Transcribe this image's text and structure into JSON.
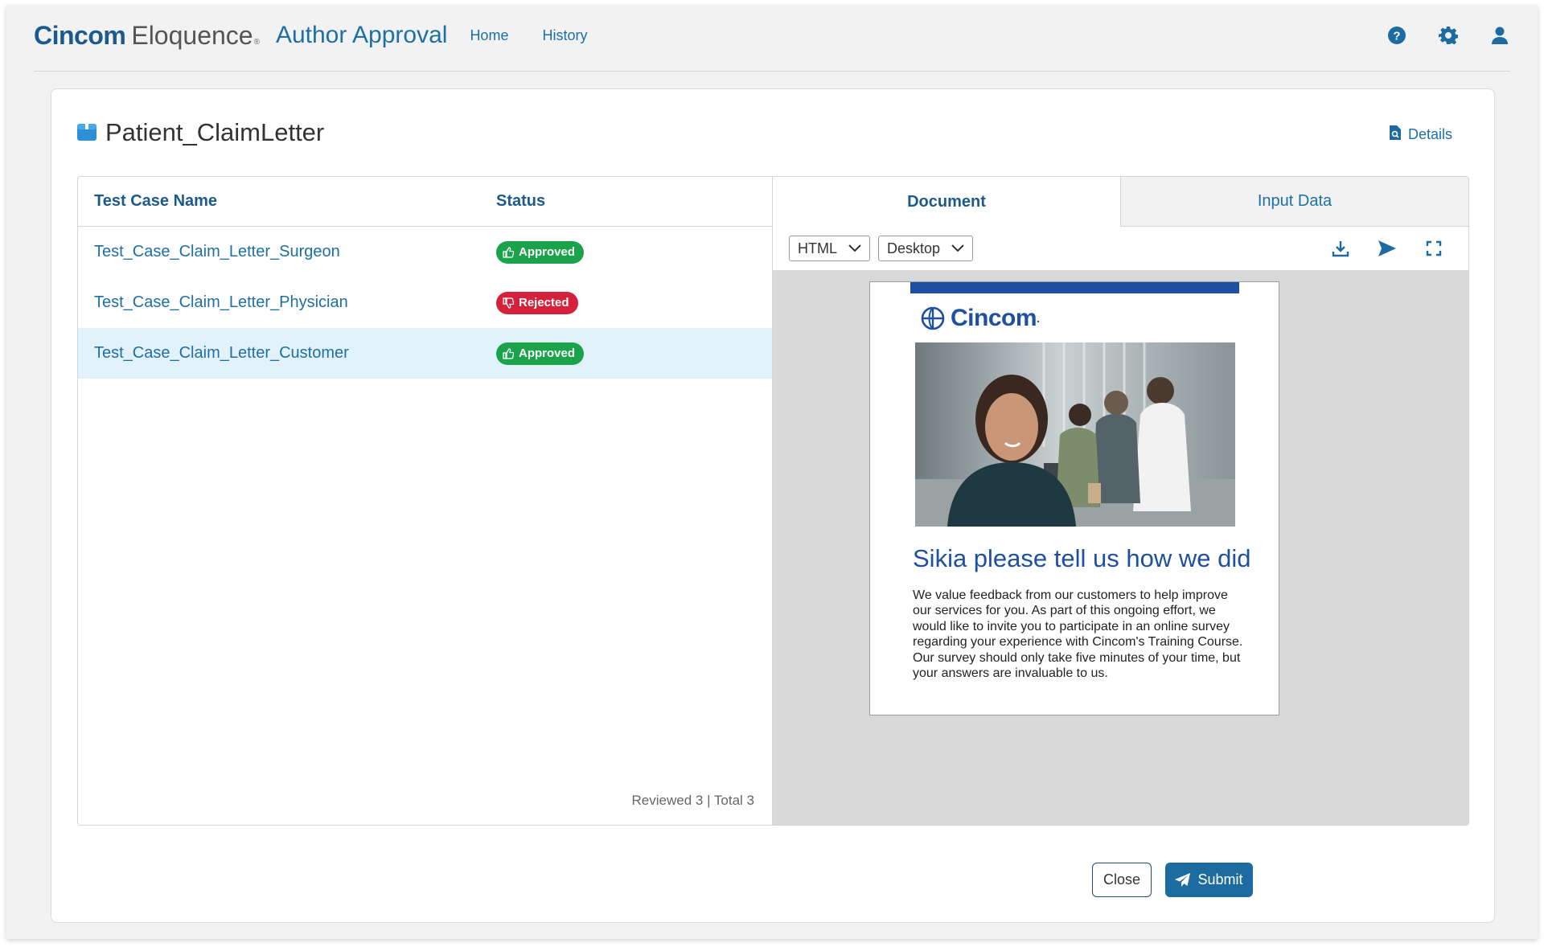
{
  "header": {
    "brand_primary": "Cincom",
    "brand_secondary": "Eloquence",
    "brand_mark": "®",
    "app_title": "Author Approval",
    "nav": [
      "Home",
      "History"
    ],
    "icons": [
      "help-icon",
      "gear-icon",
      "user-icon"
    ]
  },
  "card": {
    "title": "Patient_ClaimLetter",
    "details_label": "Details"
  },
  "table": {
    "columns": [
      "Test Case Name",
      "Status"
    ],
    "rows": [
      {
        "name": "Test_Case_Claim_Letter_Surgeon",
        "status": "Approved"
      },
      {
        "name": "Test_Case_Claim_Letter_Physician",
        "status": "Rejected"
      },
      {
        "name": "Test_Case_Claim_Letter_Customer",
        "status": "Approved"
      }
    ],
    "selected_row": "Test_Case_Claim_Letter_Customer",
    "reviewed_text": "Reviewed 3 | Total 3"
  },
  "preview": {
    "tabs": [
      "Document",
      "Input Data"
    ],
    "active_tab": "Document",
    "format_select": "HTML",
    "device_select": "Desktop",
    "tool_icons": [
      "download-icon",
      "send-icon",
      "fullscreen-icon"
    ],
    "document": {
      "logo_text": "Cincom",
      "logo_mark": ".",
      "heading": "Sikia please tell us how we did",
      "body": "We value feedback from our customers to help improve our services for you. As part of this ongoing effort, we would like to invite you to participate in an online survey regarding your experience with Cincom's Training Course. Our survey should only take five minutes of your time, but your answers are invaluable to us."
    }
  },
  "actions": {
    "close_label": "Close",
    "submit_label": "Submit"
  },
  "colors": {
    "brand": "#1d5a8c",
    "link": "#1d6fa5",
    "approved": "#1aa34a",
    "rejected": "#d6213c",
    "selected_row": "#e2f2fa",
    "submit": "#1d6ba0",
    "doc_blue": "#1f4fa0"
  }
}
